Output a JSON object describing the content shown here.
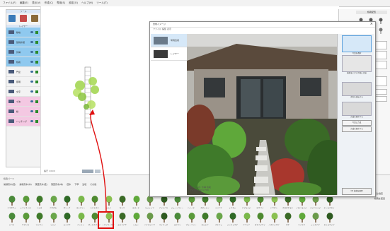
{
  "menu": [
    "ファイル(F)",
    "編集(E)",
    "表示(V)",
    "作成(C)",
    "専用(S)",
    "設定(O)",
    "ヘルプ(H)",
    "ツール(T)"
  ],
  "left_panel": {
    "title": "ツール",
    "sub_title": "レイヤー",
    "layers": [
      {
        "label": "敷地",
        "color": "blue"
      },
      {
        "label": "建物外観",
        "color": "blue"
      },
      {
        "label": "外構",
        "color": "blue"
      },
      {
        "label": "植栽",
        "color": "blue"
      },
      {
        "label": "門扉",
        "color": ""
      },
      {
        "label": "照明",
        "color": ""
      },
      {
        "label": "文字",
        "color": ""
      },
      {
        "label": "寸法",
        "color": "pink"
      },
      {
        "label": "線",
        "color": "pink"
      },
      {
        "label": "ハッチング",
        "color": "pink"
      }
    ]
  },
  "canvas": {
    "zoom_text": "縮尺 1/100"
  },
  "right_panel": {
    "title": "植栽配置",
    "labels": [
      "高さ",
      "幅",
      "縮尺",
      "表示",
      "回転",
      "間隔"
    ],
    "lower": [
      "高さ指定",
      "植栽を配置"
    ]
  },
  "dialog": {
    "title": "合成イメージ",
    "menu": [
      "ファイル",
      "編集",
      "表示"
    ],
    "options": [
      {
        "label": "写真合成"
      },
      {
        "label": "レイヤー"
      }
    ],
    "thumbs": [
      {
        "caption": "写真を選択"
      },
      {
        "caption": "植栽を上から写真に合成"
      },
      {
        "caption": "左右を反転する"
      },
      {
        "caption": "合成を保存する"
      }
    ],
    "buttons": [
      "写真に合成",
      "合成を保存する"
    ],
    "close_label": "OK  植栽を配置",
    "footer": [
      "ファイル名: 外構 植栽",
      "サイズ: 1024×768"
    ]
  },
  "bottom": {
    "title": "植栽パーツ",
    "tabs": [
      "常緑高木(低)",
      "常緑高木(中)",
      "落葉高木(低)",
      "落葉高木(中)",
      "低木",
      "下草",
      "生垣",
      "その他"
    ],
    "plants": [
      "ヤマボウシ",
      "シマトネリコ",
      "ソヨゴ",
      "アオダモ",
      "オリーブ",
      "コニファー",
      "ハナミズキ",
      "モミジ",
      "カツラ",
      "エゴノキ",
      "ヒメシャラ",
      "ナツツバキ",
      "ジューンベリー",
      "ハイノキ",
      "カクレミノ",
      "ツリバナ",
      "シラカシ",
      "ヤマモミジ",
      "ロウバイ",
      "ドウダン",
      "クロガネモチ",
      "イロハモミジ",
      "ミツバツツジ",
      "キンモクセイ",
      "ツバキ",
      "サザンカ",
      "アジサイ",
      "ツツジ",
      "ヒイラギ",
      "ナンテン",
      "ボックスウッド",
      "トキワマンサク",
      "ユキヤナギ",
      "レモン",
      "ハナカイドウ",
      "ライラック",
      "コデマリ",
      "ブルーベリー",
      "カルミア",
      "クチナシ",
      "ジンチョウゲ",
      "アベリア",
      "ガクアジサイ",
      "ハクチョウゲ",
      "ボケ",
      "マンサク",
      "シャクナゲ",
      "セイヨウツゲ"
    ]
  },
  "colors": {
    "accent": "#e01010",
    "panel_blue": "#8fc9ef",
    "panel_pink": "#f4c8e2"
  }
}
